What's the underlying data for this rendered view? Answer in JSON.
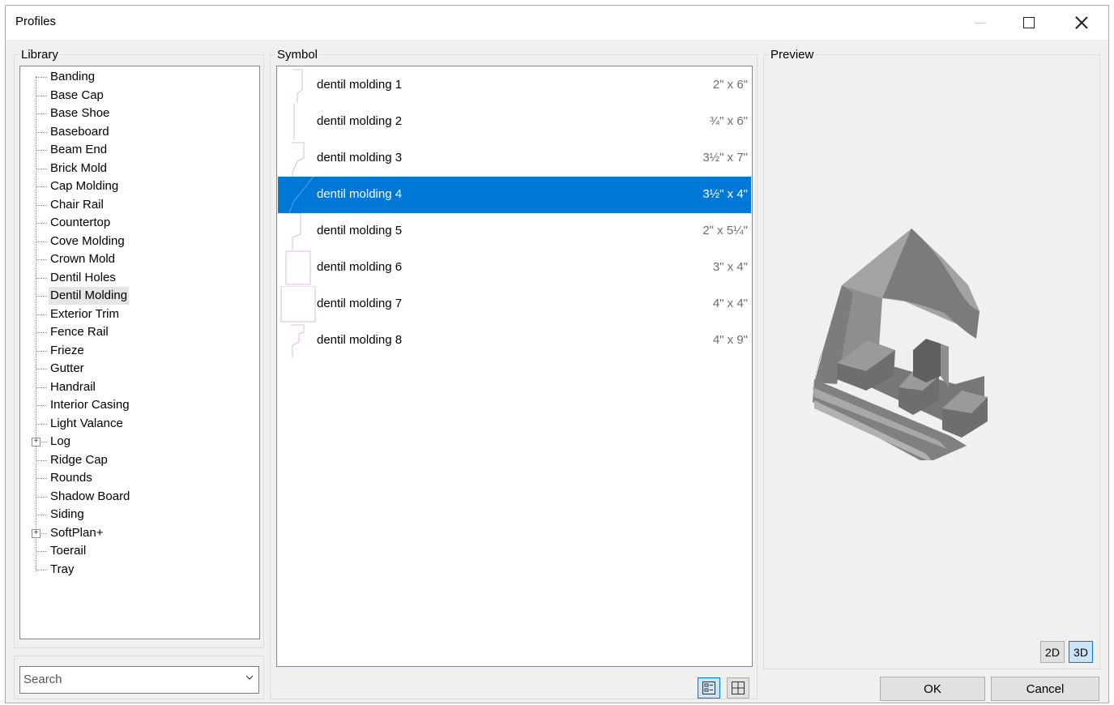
{
  "window": {
    "title": "Profiles"
  },
  "library": {
    "label": "Library",
    "items": [
      {
        "label": "Banding",
        "expandable": false
      },
      {
        "label": "Base Cap",
        "expandable": false
      },
      {
        "label": "Base Shoe",
        "expandable": false
      },
      {
        "label": "Baseboard",
        "expandable": false
      },
      {
        "label": "Beam End",
        "expandable": false
      },
      {
        "label": "Brick Mold",
        "expandable": false
      },
      {
        "label": "Cap Molding",
        "expandable": false
      },
      {
        "label": "Chair Rail",
        "expandable": false
      },
      {
        "label": "Countertop",
        "expandable": false
      },
      {
        "label": "Cove Molding",
        "expandable": false
      },
      {
        "label": "Crown Mold",
        "expandable": false
      },
      {
        "label": "Dentil Holes",
        "expandable": false
      },
      {
        "label": "Dentil Molding",
        "expandable": false,
        "selected": true
      },
      {
        "label": "Exterior Trim",
        "expandable": false
      },
      {
        "label": "Fence Rail",
        "expandable": false
      },
      {
        "label": "Frieze",
        "expandable": false
      },
      {
        "label": "Gutter",
        "expandable": false
      },
      {
        "label": "Handrail",
        "expandable": false
      },
      {
        "label": "Interior Casing",
        "expandable": false
      },
      {
        "label": "Light Valance",
        "expandable": false
      },
      {
        "label": "Log",
        "expandable": true
      },
      {
        "label": "Ridge Cap",
        "expandable": false
      },
      {
        "label": "Rounds",
        "expandable": false
      },
      {
        "label": "Shadow Board",
        "expandable": false
      },
      {
        "label": "Siding",
        "expandable": false
      },
      {
        "label": "SoftPlan+",
        "expandable": true
      },
      {
        "label": "Toerail",
        "expandable": false
      },
      {
        "label": "Tray",
        "expandable": false
      }
    ]
  },
  "search": {
    "placeholder": "Search",
    "value": ""
  },
  "symbol": {
    "label": "Symbol",
    "items": [
      {
        "name": "dentil molding 1",
        "size": "2\" x 6\""
      },
      {
        "name": "dentil molding 2",
        "size": "¾\" x 6\""
      },
      {
        "name": "dentil molding 3",
        "size": "3½\" x 7\""
      },
      {
        "name": "dentil molding 4",
        "size": "3½\" x 4\"",
        "selected": true
      },
      {
        "name": "dentil molding 5",
        "size": "2\" x 5¼\""
      },
      {
        "name": "dentil molding 6",
        "size": "3\" x 4\""
      },
      {
        "name": "dentil molding 7",
        "size": "4\" x 4\""
      },
      {
        "name": "dentil molding 8",
        "size": "4\" x 9\""
      }
    ],
    "view_modes": [
      "list-view-icon",
      "grid-view-icon"
    ],
    "active_view": "list"
  },
  "preview": {
    "label": "Preview",
    "btn_2d": "2D",
    "btn_3d": "3D",
    "active_mode": "3D"
  },
  "buttons": {
    "ok": "OK",
    "cancel": "Cancel"
  },
  "colors": {
    "selection": "#0078d7",
    "profile_outline": "#e0b8e6",
    "model_gray": "#8a8a8a"
  }
}
